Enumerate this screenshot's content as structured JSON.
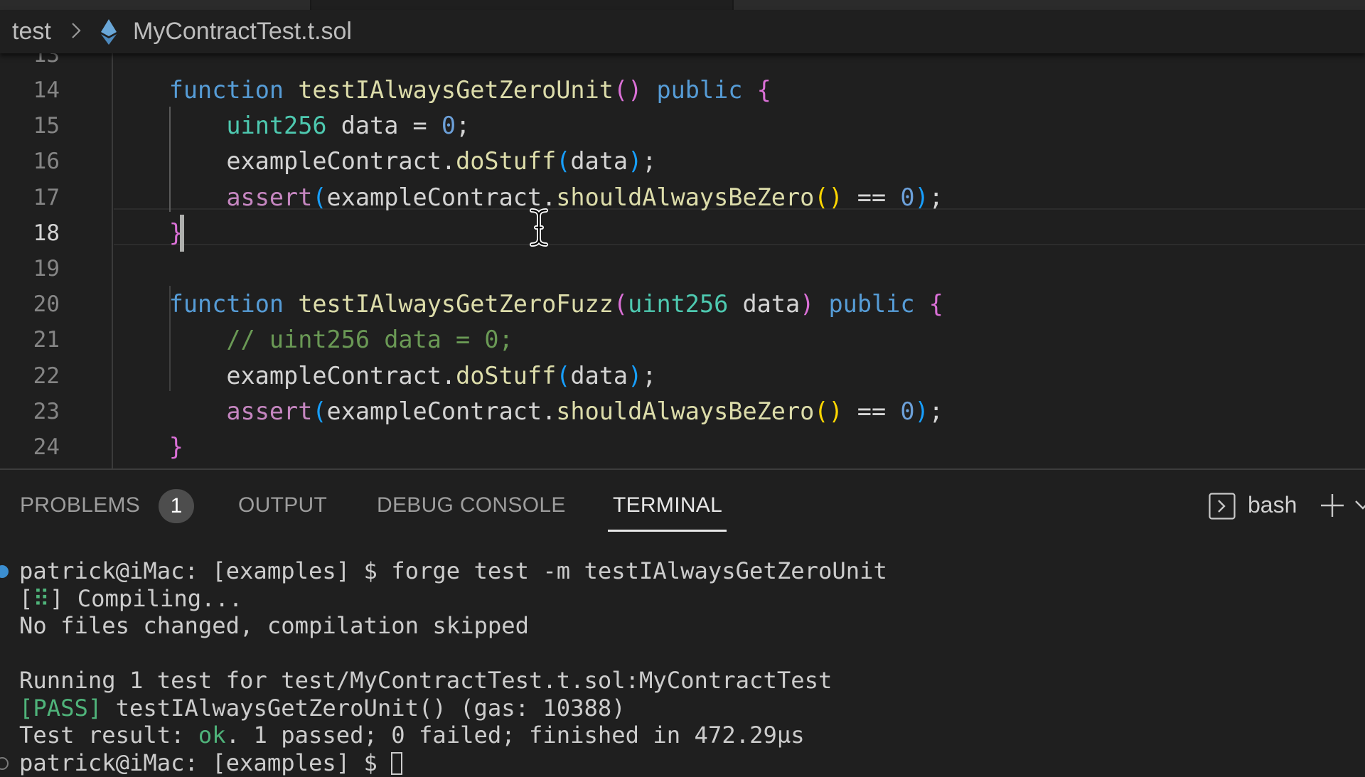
{
  "tabs": {
    "count_visible": 3,
    "active_index": 1
  },
  "breadcrumb": {
    "folder": "test",
    "file_icon": "ethereum-solidity-icon",
    "file": "MyContractTest.t.sol"
  },
  "editor": {
    "partial_top_line": "13",
    "current_line": 18,
    "lines": [
      {
        "n": "14",
        "tokens": [
          {
            "t": "    ",
            "c": ""
          },
          {
            "t": "function",
            "c": "k-fn"
          },
          {
            "t": " ",
            "c": ""
          },
          {
            "t": "testIAlwaysGetZeroUnit",
            "c": "k-name"
          },
          {
            "t": "()",
            "c": "b2"
          },
          {
            "t": " ",
            "c": ""
          },
          {
            "t": "public",
            "c": "k-fn"
          },
          {
            "t": " ",
            "c": ""
          },
          {
            "t": "{",
            "c": "b2"
          }
        ]
      },
      {
        "n": "15",
        "tokens": [
          {
            "t": "        ",
            "c": ""
          },
          {
            "t": "uint256",
            "c": "k-type"
          },
          {
            "t": " data = ",
            "c": ""
          },
          {
            "t": "0",
            "c": "k-num"
          },
          {
            "t": ";",
            "c": ""
          }
        ]
      },
      {
        "n": "16",
        "tokens": [
          {
            "t": "        exampleContract.",
            "c": ""
          },
          {
            "t": "doStuff",
            "c": "k-name"
          },
          {
            "t": "(",
            "c": "b3"
          },
          {
            "t": "data",
            "c": ""
          },
          {
            "t": ")",
            "c": "b3"
          },
          {
            "t": ";",
            "c": ""
          }
        ]
      },
      {
        "n": "17",
        "tokens": [
          {
            "t": "        ",
            "c": ""
          },
          {
            "t": "assert",
            "c": "k-assert"
          },
          {
            "t": "(",
            "c": "b3"
          },
          {
            "t": "exampleContract.",
            "c": ""
          },
          {
            "t": "shouldAlwaysBeZero",
            "c": "k-name"
          },
          {
            "t": "()",
            "c": "b1"
          },
          {
            "t": " == ",
            "c": ""
          },
          {
            "t": "0",
            "c": "k-num"
          },
          {
            "t": ")",
            "c": "b3"
          },
          {
            "t": ";",
            "c": ""
          }
        ]
      },
      {
        "n": "18",
        "tokens": [
          {
            "t": "    ",
            "c": ""
          },
          {
            "t": "}",
            "c": "b2"
          }
        ]
      },
      {
        "n": "19",
        "tokens": []
      },
      {
        "n": "20",
        "tokens": [
          {
            "t": "    ",
            "c": ""
          },
          {
            "t": "function",
            "c": "k-fn"
          },
          {
            "t": " ",
            "c": ""
          },
          {
            "t": "testIAlwaysGetZeroFuzz",
            "c": "k-name"
          },
          {
            "t": "(",
            "c": "b2"
          },
          {
            "t": "uint256",
            "c": "k-type"
          },
          {
            "t": " data",
            "c": ""
          },
          {
            "t": ")",
            "c": "b2"
          },
          {
            "t": " ",
            "c": ""
          },
          {
            "t": "public",
            "c": "k-fn"
          },
          {
            "t": " ",
            "c": ""
          },
          {
            "t": "{",
            "c": "b2"
          }
        ]
      },
      {
        "n": "21",
        "tokens": [
          {
            "t": "        ",
            "c": ""
          },
          {
            "t": "// uint256 data = 0;",
            "c": "k-cmt"
          }
        ]
      },
      {
        "n": "22",
        "tokens": [
          {
            "t": "        exampleContract.",
            "c": ""
          },
          {
            "t": "doStuff",
            "c": "k-name"
          },
          {
            "t": "(",
            "c": "b3"
          },
          {
            "t": "data",
            "c": ""
          },
          {
            "t": ")",
            "c": "b3"
          },
          {
            "t": ";",
            "c": ""
          }
        ]
      },
      {
        "n": "23",
        "tokens": [
          {
            "t": "        ",
            "c": ""
          },
          {
            "t": "assert",
            "c": "k-assert"
          },
          {
            "t": "(",
            "c": "b3"
          },
          {
            "t": "exampleContract.",
            "c": ""
          },
          {
            "t": "shouldAlwaysBeZero",
            "c": "k-name"
          },
          {
            "t": "()",
            "c": "b1"
          },
          {
            "t": " == ",
            "c": ""
          },
          {
            "t": "0",
            "c": "k-num"
          },
          {
            "t": ")",
            "c": "b3"
          },
          {
            "t": ";",
            "c": ""
          }
        ]
      },
      {
        "n": "24",
        "tokens": [
          {
            "t": "    ",
            "c": ""
          },
          {
            "t": "}",
            "c": "b2"
          }
        ]
      }
    ]
  },
  "panel": {
    "tabs": [
      {
        "label": "PROBLEMS",
        "badge": "1"
      },
      {
        "label": "OUTPUT"
      },
      {
        "label": "DEBUG CONSOLE"
      },
      {
        "label": "TERMINAL",
        "active": true
      }
    ],
    "terminal_name": "bash",
    "terminal_icon": "terminal-icon",
    "new_terminal_icon": "plus-icon",
    "dropdown_icon": "chevron-down-icon"
  },
  "terminal": {
    "lines": [
      {
        "prompt_dot": "blue",
        "segments": [
          {
            "t": "patrick@iMac: [examples] $ forge test -m testIAlwaysGetZeroUnit",
            "c": ""
          }
        ]
      },
      {
        "segments": [
          {
            "t": "[",
            "c": ""
          },
          {
            "t": "⠿",
            "c": "t-spin"
          },
          {
            "t": "] Compiling...",
            "c": ""
          }
        ]
      },
      {
        "segments": [
          {
            "t": "No files changed, compilation skipped",
            "c": ""
          }
        ]
      },
      {
        "segments": []
      },
      {
        "segments": [
          {
            "t": "Running 1 test for test/MyContractTest.t.sol:MyContractTest",
            "c": ""
          }
        ]
      },
      {
        "segments": [
          {
            "t": "[PASS]",
            "c": "t-green"
          },
          {
            "t": " testIAlwaysGetZeroUnit() (gas: 10388)",
            "c": ""
          }
        ]
      },
      {
        "segments": [
          {
            "t": "Test result: ",
            "c": ""
          },
          {
            "t": "ok",
            "c": "t-green"
          },
          {
            "t": ". 1 passed; 0 failed; finished in 472.29µs",
            "c": ""
          }
        ]
      },
      {
        "prompt_dot": "hollow",
        "cursor": true,
        "segments": [
          {
            "t": "patrick@iMac: [examples] $ ",
            "c": ""
          }
        ]
      }
    ]
  },
  "colors": {
    "background": "#1f1f1f",
    "keyword": "#569cd6",
    "function_name": "#dcdcaa",
    "type": "#4ec9b0",
    "comment": "#6a9955",
    "pass_green": "#4fb37a",
    "bracket_level1": "#ffd700",
    "bracket_level2": "#da70d6",
    "bracket_level3": "#179fff"
  }
}
